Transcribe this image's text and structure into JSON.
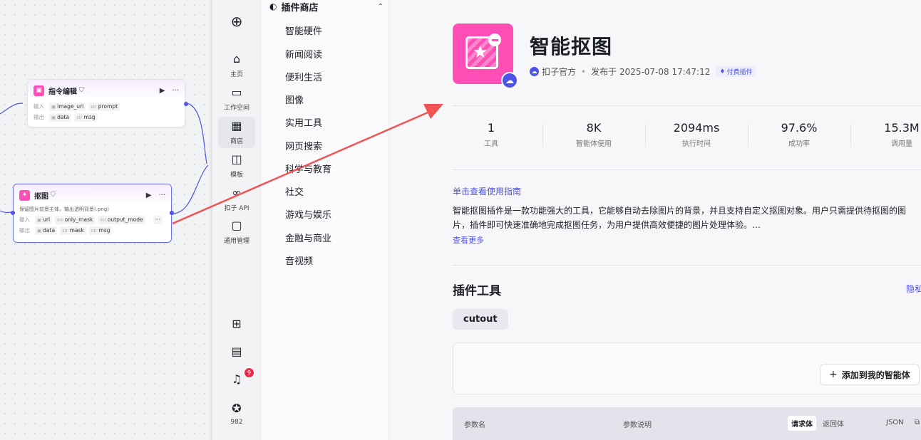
{
  "canvas": {
    "node1": {
      "title": "指令编辑",
      "inputs_label": "输入",
      "inputs": [
        {
          "type": "img",
          "name": "image_url"
        },
        {
          "type": "str",
          "name": "prompt"
        }
      ],
      "outputs_label": "输出",
      "outputs": [
        {
          "type": "img",
          "name": "data"
        },
        {
          "type": "str",
          "name": "msg"
        }
      ]
    },
    "node2": {
      "title": "抠图",
      "description": "保留图片前景主体，输出透明背景(.png)",
      "inputs_label": "输入",
      "inputs": [
        {
          "type": "img",
          "name": "url"
        },
        {
          "type": "int",
          "name": "only_mask"
        },
        {
          "type": "int",
          "name": "output_mode"
        }
      ],
      "outputs_label": "输出",
      "outputs": [
        {
          "type": "img",
          "name": "data"
        },
        {
          "type": "str",
          "name": "mask"
        },
        {
          "type": "str",
          "name": "msg"
        }
      ]
    }
  },
  "nav": {
    "items": [
      {
        "label": "",
        "icon": "plus-circle-icon",
        "glyph": "⊕"
      },
      {
        "label": "主页",
        "icon": "home-icon",
        "glyph": "⌂"
      },
      {
        "label": "工作空间",
        "icon": "terminal-icon",
        "glyph": "▭"
      },
      {
        "label": "商店",
        "icon": "store-icon",
        "glyph": "▦"
      },
      {
        "label": "模板",
        "icon": "template-icon",
        "glyph": "◫"
      },
      {
        "label": "扣子 API",
        "icon": "api-icon",
        "glyph": "∞"
      },
      {
        "label": "通用管理",
        "icon": "inbox-icon",
        "glyph": "▢"
      }
    ],
    "bottom": [
      {
        "icon": "apps-icon",
        "glyph": "⊞"
      },
      {
        "icon": "doc-icon",
        "glyph": "▤"
      },
      {
        "icon": "bell-icon",
        "glyph": "🔔",
        "badge": "9"
      },
      {
        "icon": "star-icon",
        "glyph": "✪",
        "label": "982"
      }
    ]
  },
  "categories": {
    "header": "插件商店",
    "items": [
      "智能硬件",
      "新闻阅读",
      "便利生活",
      "图像",
      "实用工具",
      "网页搜索",
      "科学与教育",
      "社交",
      "游戏与娱乐",
      "金融与商业",
      "音视频"
    ]
  },
  "plugin": {
    "name": "智能抠图",
    "author": "扣子官方",
    "published": "发布于 2025-07-08 17:47:12",
    "paid_badge": "付费插件",
    "stats": [
      {
        "value": "1",
        "label": "工具"
      },
      {
        "value": "8K",
        "label": "智能体使用"
      },
      {
        "value": "2094ms",
        "label": "执行时间"
      },
      {
        "value": "97.6%",
        "label": "成功率"
      },
      {
        "value": "15.3M",
        "label": "调用量"
      }
    ],
    "guide_link": "单击查看使用指南",
    "description_lines": [
      "智能抠图插件是一款功能强大的工具，它能够自动去除图片的背景，并且支持自定义抠图对象。用户只需提供待抠图的图",
      "片，插件即可快速准确地完成抠图任务，为用户提供高效便捷的图片处理体验。…"
    ],
    "more_link": "查看更多",
    "tools_title": "插件工具",
    "privacy_link": "隐私",
    "tool_name": "cutout",
    "add_button": "添加到我的智能体",
    "table": {
      "col_name": "参数名",
      "col_desc": "参数说明",
      "tab_request": "请求体",
      "tab_response": "返回体",
      "json_label": "JSON"
    }
  },
  "colors": {
    "accent": "#4d53e8",
    "logo": "#ff4fb6",
    "arrow": "#f05454"
  }
}
